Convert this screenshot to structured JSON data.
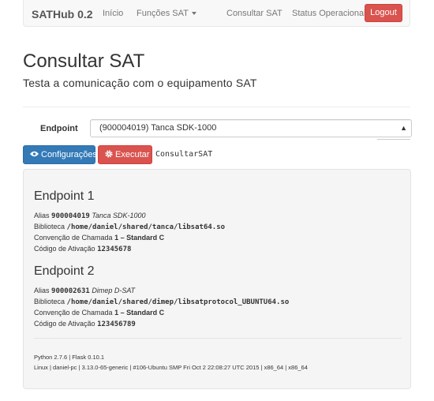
{
  "navbar": {
    "brand": "SATHub 0.2",
    "links": [
      "Início",
      "Funções SAT",
      "Consultar SAT",
      "Status Operacional"
    ],
    "dropdown_icon": "caret-down-icon",
    "logout_label": "Logout"
  },
  "page": {
    "title": "Consultar SAT",
    "subtitle": "Testa a comunicação com o equipamento SAT"
  },
  "form": {
    "endpoint_label": "Endpoint",
    "endpoint_selected": "(900004019) Tanca SDK-1000",
    "select_arrow_icon": "updown-arrow-icon",
    "config_button": "Configurações",
    "config_icon": "eye-icon",
    "execute_button": "Executar",
    "execute_icon": "gear-icon",
    "command_name": "ConsultarSAT"
  },
  "endpoints": [
    {
      "title": "Endpoint 1",
      "alias_label": "Alias",
      "alias_code": "900004019",
      "alias_name": "Tanca SDK-1000",
      "library_label": "Biblioteca",
      "library_path": "/home/daniel/shared/tanca/libsat64.so",
      "convention_label": "Convenção de Chamada",
      "convention_value": "1 – Standard C",
      "activation_label": "Código de Ativação",
      "activation_code": "12345678"
    },
    {
      "title": "Endpoint 2",
      "alias_label": "Alias",
      "alias_code": "900002631",
      "alias_name": "Dimep D-SAT",
      "library_label": "Biblioteca",
      "library_path": "/home/daniel/shared/dimep/libsatprotocol_UBUNTU64.so",
      "convention_label": "Convenção de Chamada",
      "convention_value": "1 – Standard C",
      "activation_label": "Código de Ativação",
      "activation_code": "123456789"
    }
  ],
  "system": {
    "versions": "Python 2.7.6 | Flask 0.10.1",
    "platform": "Linux | daniel-pc | 3.13.0-65-generic | #106-Ubuntu SMP Fri Oct 2 22:08:27 UTC 2015 | x86_64 | x86_64"
  },
  "colors": {
    "primary": "#337ab7",
    "danger": "#d9534f",
    "navbar_bg": "#f8f8f8",
    "well_bg": "#f5f5f5"
  }
}
